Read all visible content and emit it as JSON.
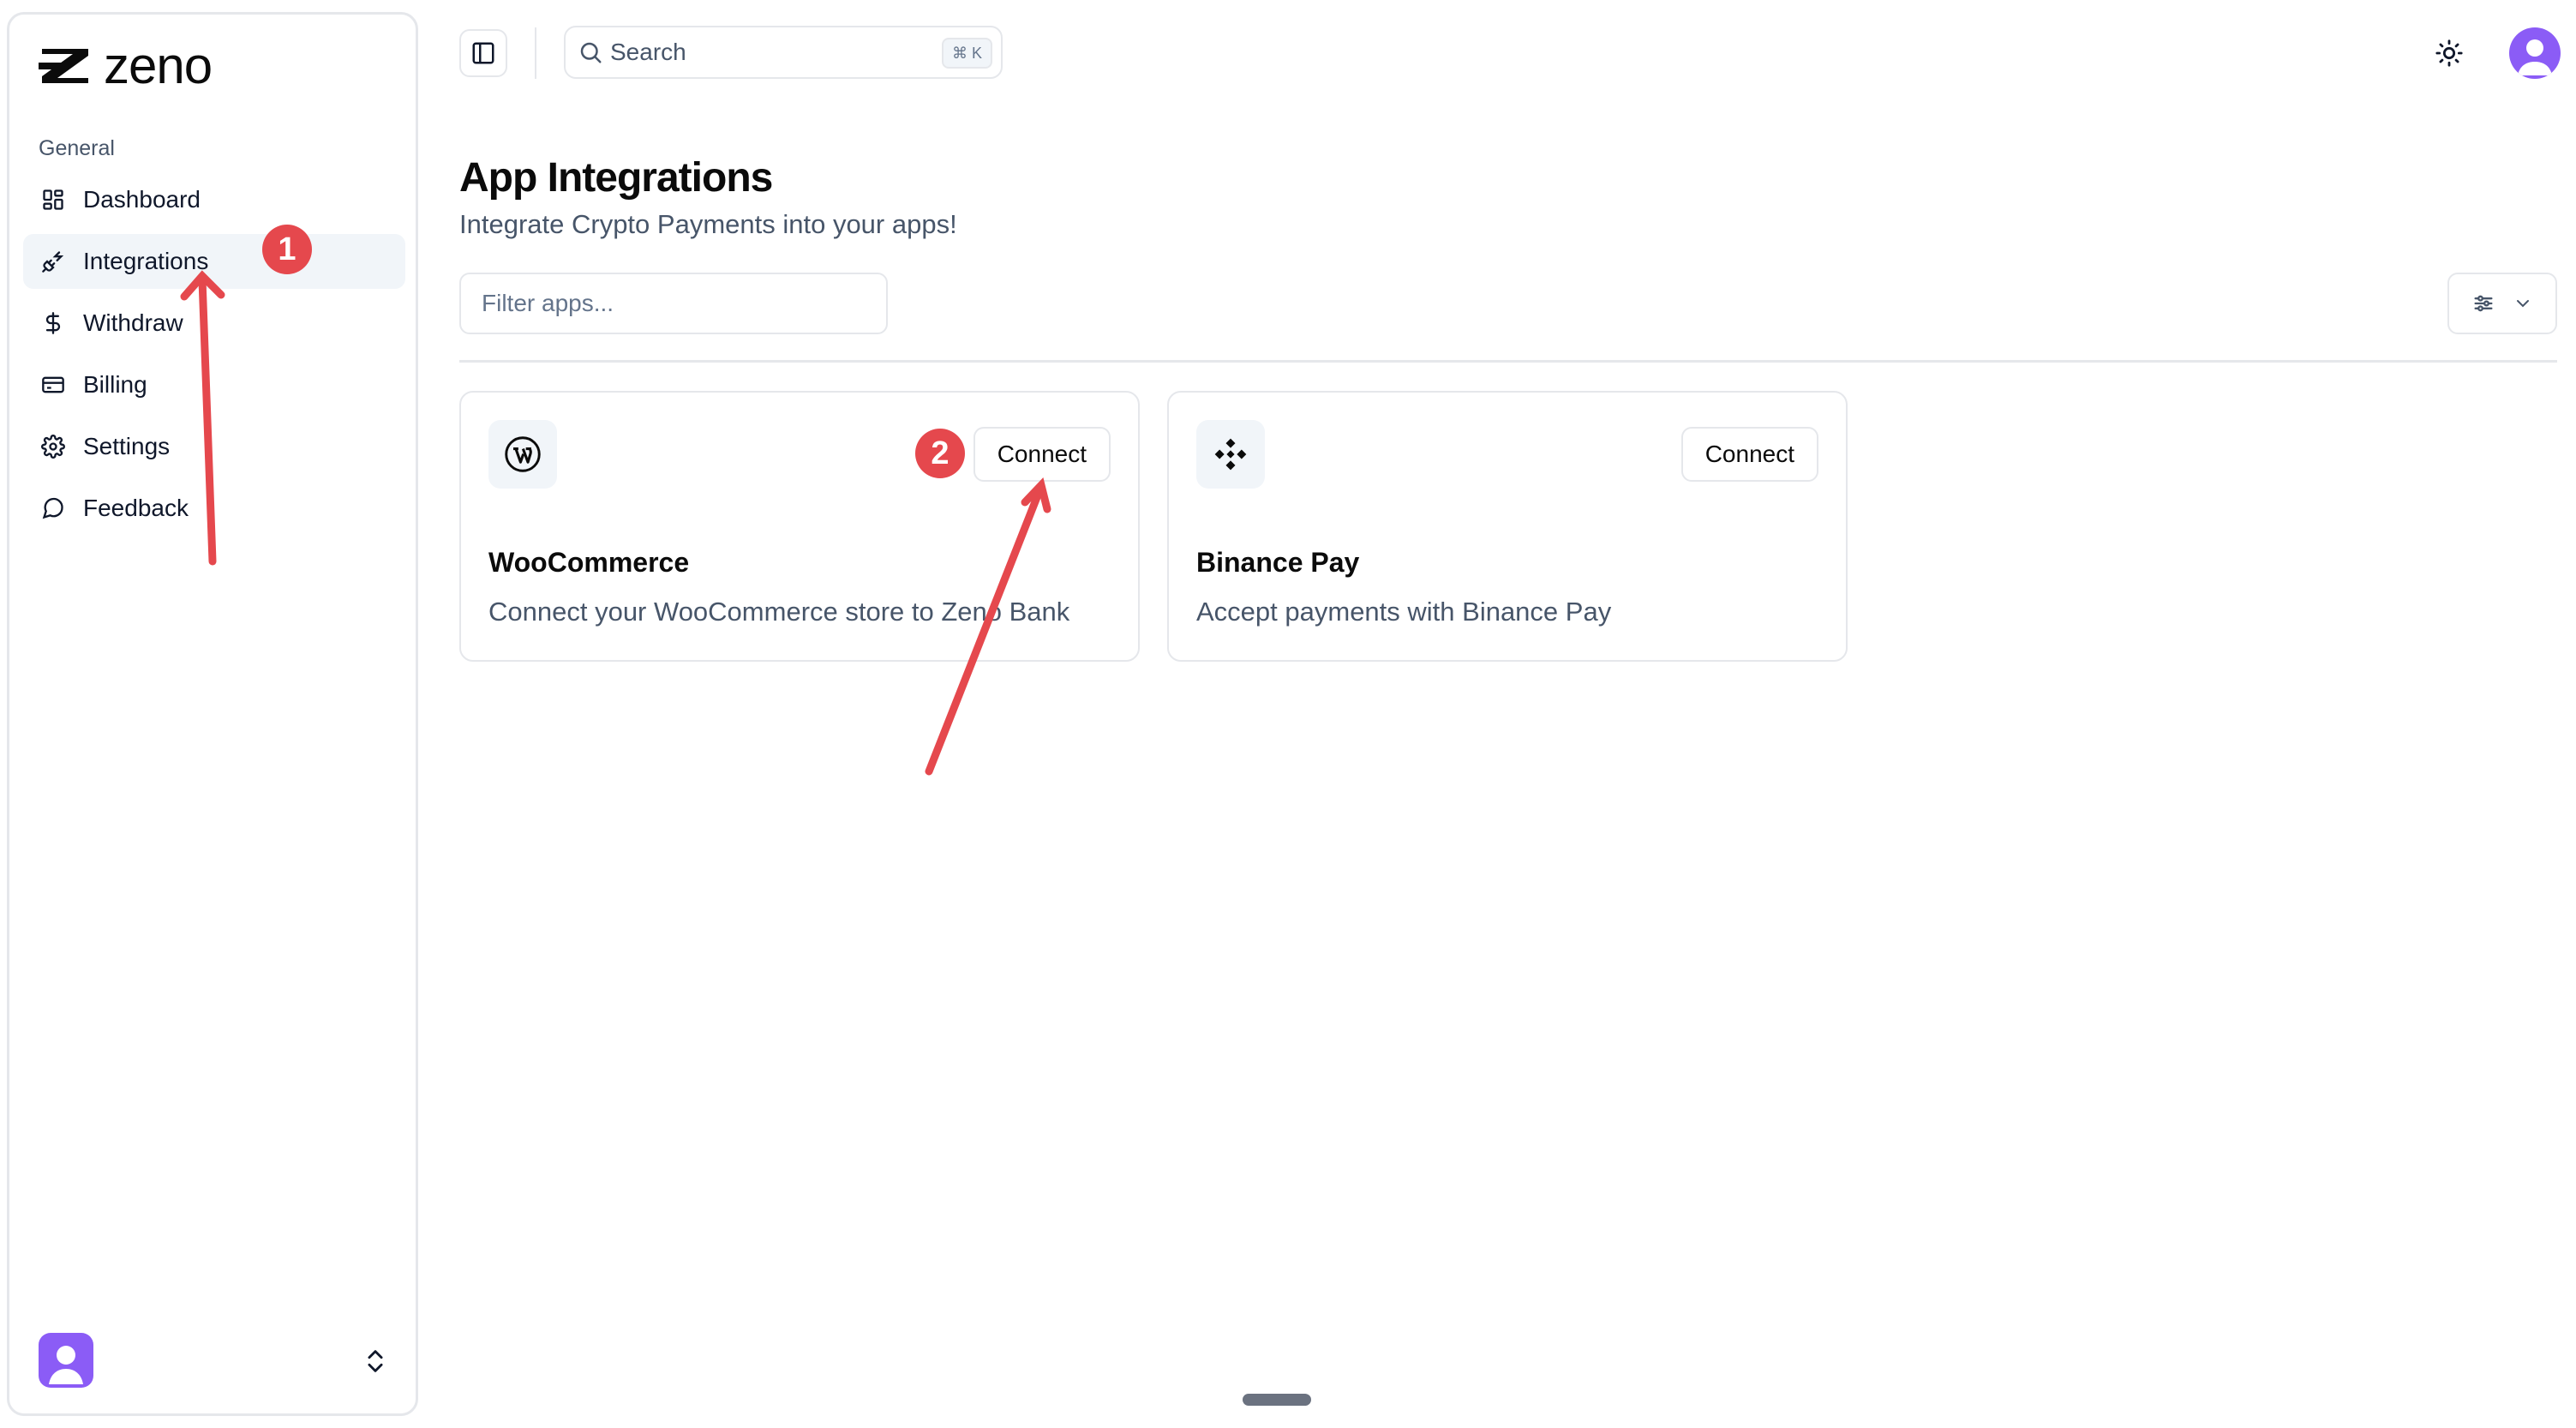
{
  "brand": {
    "name": "zeno"
  },
  "sidebar": {
    "group_label": "General",
    "items": [
      {
        "label": "Dashboard",
        "icon": "dashboard-icon"
      },
      {
        "label": "Integrations",
        "icon": "plug-icon",
        "active": true
      },
      {
        "label": "Withdraw",
        "icon": "dollar-icon"
      },
      {
        "label": "Billing",
        "icon": "credit-card-icon"
      },
      {
        "label": "Settings",
        "icon": "gear-icon"
      },
      {
        "label": "Feedback",
        "icon": "message-circle-icon"
      }
    ]
  },
  "topbar": {
    "search_label": "Search",
    "search_shortcut": "⌘ K"
  },
  "page": {
    "title": "App Integrations",
    "subtitle": "Integrate Crypto Payments into your apps!",
    "filter_placeholder": "Filter apps..."
  },
  "integrations": [
    {
      "name": "WooCommerce",
      "description": "Connect your WooCommerce store to Zeno Bank",
      "button": "Connect",
      "icon": "wordpress-icon"
    },
    {
      "name": "Binance Pay",
      "description": "Accept payments with Binance Pay",
      "button": "Connect",
      "icon": "binance-icon"
    }
  ],
  "annotations": [
    {
      "number": "1"
    },
    {
      "number": "2"
    }
  ],
  "colors": {
    "accent_red": "#e5484d",
    "avatar_purple": "#8b5cf6",
    "border": "#e5e7eb",
    "muted_text": "#475569"
  }
}
